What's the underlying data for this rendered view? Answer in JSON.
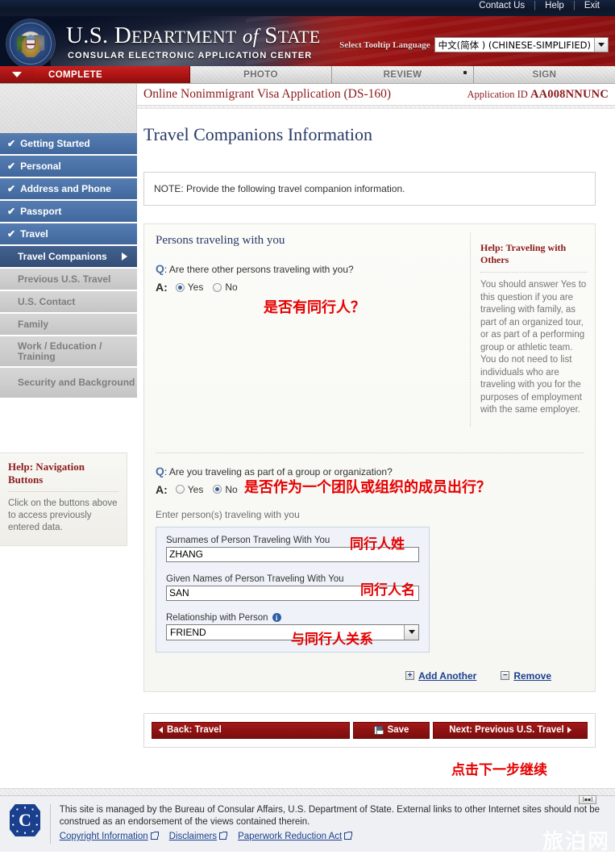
{
  "topbar": {
    "links": [
      "Contact Us",
      "Help",
      "Exit"
    ]
  },
  "banner": {
    "title_us": "U.S.",
    "title_dept": "D",
    "title_dept_rest": "EPARTMENT",
    "title_of": "of",
    "title_state_cap": "S",
    "title_state_rest": "TATE",
    "subtitle": "CONSULAR ELECTRONIC APPLICATION CENTER",
    "language_label": "Select Tooltip Language",
    "language_value": "中文(简体 ) (CHINESE-SIMPLIFIED)",
    "seal_name": "department-of-state-seal"
  },
  "tabs": [
    {
      "label": "COMPLETE",
      "state": "active"
    },
    {
      "label": "PHOTO",
      "state": "inactive"
    },
    {
      "label": "REVIEW",
      "state": "inactive"
    },
    {
      "label": "SIGN",
      "state": "inactive"
    }
  ],
  "sidebar": {
    "items": [
      {
        "label": "Getting Started",
        "state": "done"
      },
      {
        "label": "Personal",
        "state": "done"
      },
      {
        "label": "Address and Phone",
        "state": "done"
      },
      {
        "label": "Passport",
        "state": "done"
      },
      {
        "label": "Travel",
        "state": "done"
      },
      {
        "label": "Travel Companions",
        "state": "current"
      },
      {
        "label": "Previous U.S. Travel",
        "state": "pending"
      },
      {
        "label": "U.S. Contact",
        "state": "pending"
      },
      {
        "label": "Family",
        "state": "pending"
      },
      {
        "label": "Work / Education / Training",
        "state": "pending"
      },
      {
        "label": "Security and Background",
        "state": "pending"
      }
    ],
    "help": {
      "title_prefix": "Help:",
      "title": "Help: Navigation Buttons",
      "body": "Click on the buttons above to access previously entered data."
    }
  },
  "main": {
    "app_title": "Online Nonimmigrant Visa Application (DS-160)",
    "app_id_label": "Application ID",
    "app_id_value": "AA008NNUNC",
    "page_title": "Travel Companions Information",
    "note": "NOTE: Provide the following travel companion information.",
    "section_heading": "Persons traveling with you",
    "q1": {
      "q_marker": "Q",
      "question": "Are there other persons traveling with you?",
      "a_marker": "A:",
      "options": [
        "Yes",
        "No"
      ],
      "selected": "Yes"
    },
    "q2": {
      "q_marker": "Q",
      "question": "Are you traveling as part of a group or organization?",
      "a_marker": "A:",
      "options": [
        "Yes",
        "No"
      ],
      "selected": "No"
    },
    "enter_persons_label": "Enter person(s) traveling with you",
    "fields": {
      "surname_label": "Surnames of Person Traveling With You",
      "surname_value": "ZHANG",
      "given_label": "Given Names of Person Traveling With You",
      "given_value": "SAN",
      "relationship_label": "Relationship with Person",
      "relationship_value": "FRIEND"
    },
    "add_another": "Add Another",
    "remove": "Remove",
    "help_panel": {
      "title": "Help: Traveling with Others",
      "body": "You should answer Yes to this question if you are traveling with family, as part of an organized tour, or as part of a performing group or athletic team. You do not need to list individuals who are traveling with you for the purposes of employment with the same employer."
    },
    "buttons": {
      "back": "Back: Travel",
      "save": "Save",
      "next": "Next: Previous U.S. Travel"
    }
  },
  "footer": {
    "text": "This site is managed by the Bureau of Consular Affairs, U.S. Department of State. External links to other Internet sites should not be construed as an endorsement of the views contained therein.",
    "links": [
      "Copyright Information",
      "Disclaimers",
      "Paperwork Reduction Act"
    ],
    "watermark": "旅泊网",
    "badge": "[▪▪]"
  },
  "annotations": {
    "a1": "是否有同行人？",
    "a2": "是否作为一个团队或组织的成员出行？",
    "a3": "同行人姓",
    "a4": "同行人名",
    "a5": "与同行人关系",
    "a6": "点击下一步继续"
  }
}
